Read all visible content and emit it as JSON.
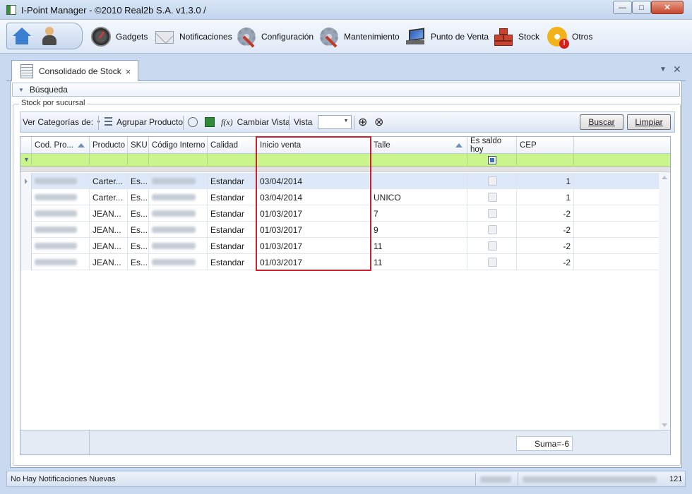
{
  "window": {
    "title": "I-Point Manager - ©2010 Real2b S.A. v1.3.0 /"
  },
  "menu": [
    {
      "label": "Gadgets",
      "icon": "gauge-icon"
    },
    {
      "label": "Notificaciones",
      "icon": "envelope-icon"
    },
    {
      "label": "Configuración",
      "icon": "gear-wrench-icon"
    },
    {
      "label": "Mantenimiento",
      "icon": "gear-wrench-icon"
    },
    {
      "label": "Punto de Venta",
      "icon": "pos-terminal-icon"
    },
    {
      "label": "Stock",
      "icon": "boxes-icon"
    },
    {
      "label": "Otros",
      "icon": "gear-warning-icon"
    }
  ],
  "tab": {
    "label": "Consolidado de Stock",
    "close": "×"
  },
  "busqueda": {
    "label": "Búsqueda"
  },
  "group": {
    "title": "Stock por sucursal"
  },
  "toolbar": {
    "ver_categorias": "Ver Categorías de:",
    "agrupar": "Agrupar Producto",
    "cambiar_vista": "Cambiar Vista",
    "vista": "Vista",
    "vista_value": "",
    "buscar": "Buscar",
    "limpiar": "Limpiar"
  },
  "grid": {
    "columns": [
      "Cod. Pro...",
      "Producto",
      "SKU",
      "Código Interno",
      "Calidad",
      "Inicio venta",
      "Talle",
      "Es saldo hoy",
      "CEP"
    ],
    "rows": [
      {
        "producto": "Carter...",
        "sku": "Es...",
        "calidad": "Estandar",
        "inicio": "03/04/2014",
        "talle": "",
        "cep": "1"
      },
      {
        "producto": "Carter...",
        "sku": "Es...",
        "calidad": "Estandar",
        "inicio": "03/04/2014",
        "talle": "UNICO",
        "cep": "1"
      },
      {
        "producto": "JEAN...",
        "sku": "Es...",
        "calidad": "Estandar",
        "inicio": "01/03/2017",
        "talle": "7",
        "cep": "-2"
      },
      {
        "producto": "JEAN...",
        "sku": "Es...",
        "calidad": "Estandar",
        "inicio": "01/03/2017",
        "talle": "9",
        "cep": "-2"
      },
      {
        "producto": "JEAN...",
        "sku": "Es...",
        "calidad": "Estandar",
        "inicio": "01/03/2017",
        "talle": "11",
        "cep": "-2"
      },
      {
        "producto": "JEAN...",
        "sku": "Es...",
        "calidad": "Estandar",
        "inicio": "01/03/2017",
        "talle": "11",
        "cep": "-2"
      }
    ],
    "sum": "Suma=-6"
  },
  "status": {
    "text": "No Hay Notificaciones Nuevas",
    "count": "121"
  },
  "colors": {
    "accent": "#3f6fb5",
    "filter_row": "#c9f58c",
    "highlight": "#d02030",
    "selected_row": "#dde8f8"
  }
}
